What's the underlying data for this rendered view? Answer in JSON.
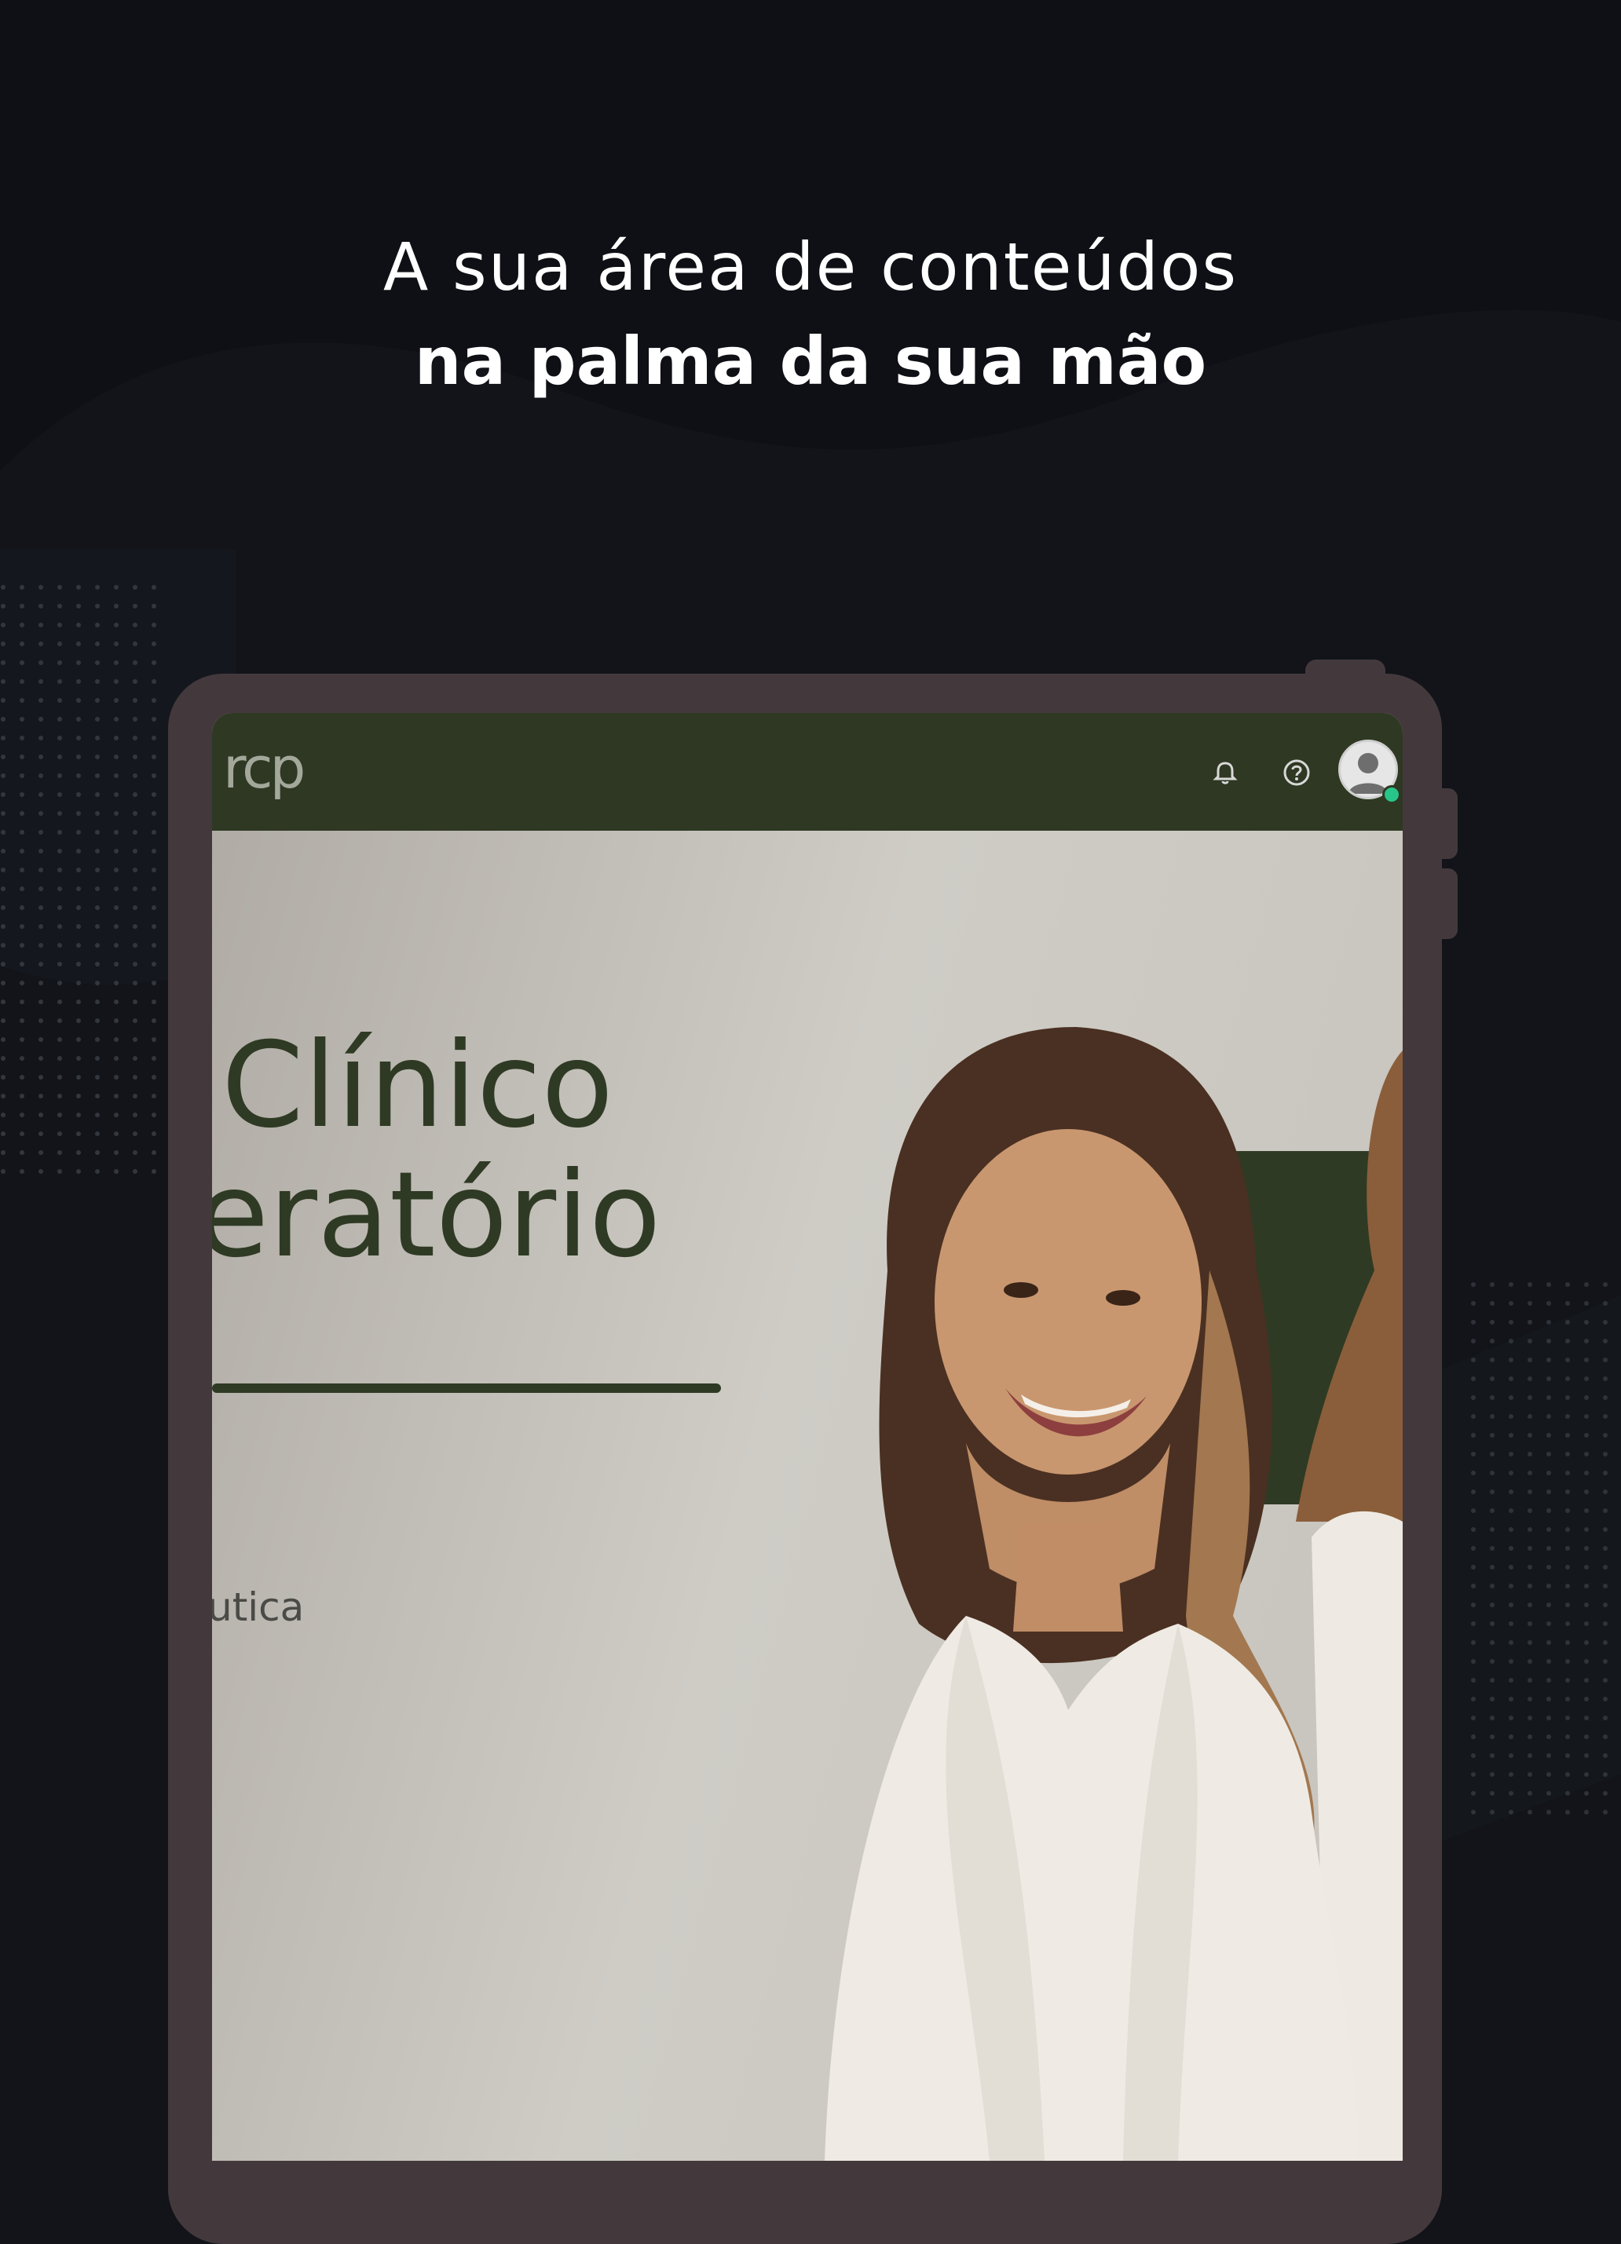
{
  "promo": {
    "line1": "A sua área de conteúdos",
    "line2": "na palma da sua mão"
  },
  "app": {
    "logo_text": "rcp",
    "header_icons": [
      "bell-icon",
      "help-icon",
      "user-avatar-icon"
    ],
    "status_color": "#27c58a",
    "header_color": "#2e3822"
  },
  "hero": {
    "title_line1": "Clínico",
    "title_line2": "eratório",
    "subtext": "utica"
  },
  "colors": {
    "background": "#121419",
    "device_frame": "#43393c",
    "accent_green": "#2f3a24"
  }
}
